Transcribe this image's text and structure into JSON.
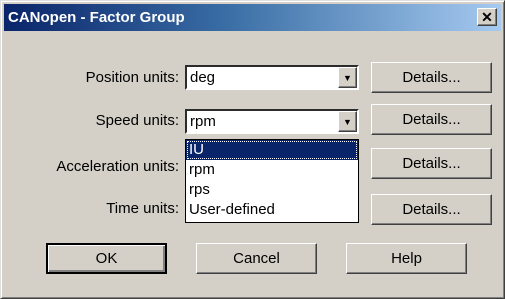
{
  "window": {
    "title": "CANopen - Factor Group"
  },
  "rows": [
    {
      "label": "Position units:",
      "value": "deg",
      "button": "Details..."
    },
    {
      "label": "Speed units:",
      "value": "rpm",
      "button": "Details..."
    },
    {
      "label": "Acceleration units:",
      "value": "",
      "button": "Details..."
    },
    {
      "label": "Time units:",
      "value": "",
      "button": "Details..."
    }
  ],
  "speed_dropdown": {
    "options": [
      "IU",
      "rpm",
      "rps",
      "User-defined"
    ],
    "highlighted": "IU"
  },
  "footer": {
    "ok": "OK",
    "cancel": "Cancel",
    "help": "Help"
  },
  "icons": {
    "close": "close-icon",
    "combo_arrow": "chevron-down-icon"
  },
  "colors": {
    "title_start": "#0a246a",
    "title_end": "#a6caf0",
    "dialog_bg": "#d4d0c8",
    "selection": "#0a246a"
  }
}
